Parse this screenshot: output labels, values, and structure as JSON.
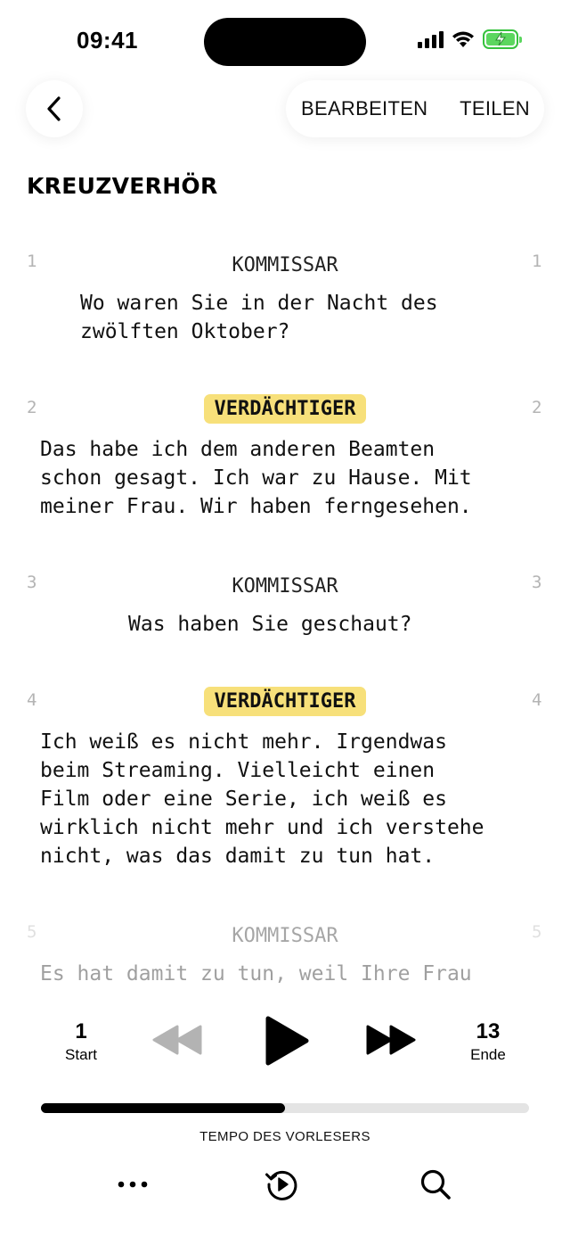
{
  "status_bar": {
    "time": "09:41"
  },
  "header": {
    "edit_label": "BEARBEITEN",
    "share_label": "TEILEN",
    "title": "KREUZVERHÖR"
  },
  "script": {
    "blocks": [
      {
        "number": "1",
        "character": "KOMMISSAR",
        "highlighted": false,
        "dialogue": "Wo waren Sie in der Nacht des\nzwölften Oktober?"
      },
      {
        "number": "2",
        "character": "VERDÄCHTIGER",
        "highlighted": true,
        "dialogue": "Das habe ich dem anderen Beamten\nschon gesagt. Ich war zu Hause. Mit\nmeiner Frau. Wir haben ferngesehen."
      },
      {
        "number": "3",
        "character": "KOMMISSAR",
        "highlighted": false,
        "dialogue": "Was haben Sie geschaut?"
      },
      {
        "number": "4",
        "character": "VERDÄCHTIGER",
        "highlighted": true,
        "dialogue": "Ich weiß es nicht mehr. Irgendwas\nbeim Streaming. Vielleicht einen\nFilm oder eine Serie, ich weiß es\nwirklich nicht mehr und ich verstehe\nnicht, was das damit zu tun hat."
      },
      {
        "number": "5",
        "character": "KOMMISSAR",
        "highlighted": false,
        "dialogue": "Es hat damit zu tun, weil Ihre Frau"
      }
    ]
  },
  "player": {
    "start_number": "1",
    "start_label": "Start",
    "end_number": "13",
    "end_label": "Ende",
    "progress_fraction": 0.5,
    "tempo_label": "TEMPO DES VORLESERS"
  },
  "toolbar": {
    "more_icon": "ellipsis-icon",
    "replay_icon": "history-play-icon",
    "search_icon": "search-icon"
  },
  "colors": {
    "highlight": "#f7e07a",
    "battery": "#5cd65f",
    "line_number": "#b4b4b4"
  }
}
